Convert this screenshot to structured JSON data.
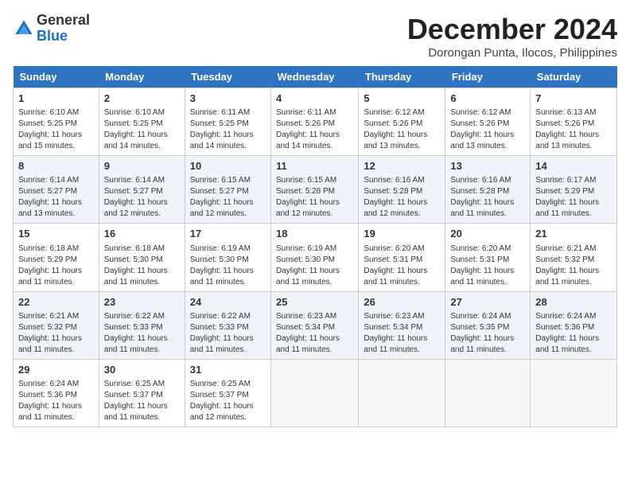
{
  "header": {
    "logo_general": "General",
    "logo_blue": "Blue",
    "month_year": "December 2024",
    "location": "Dorongan Punta, Ilocos, Philippines"
  },
  "columns": [
    "Sunday",
    "Monday",
    "Tuesday",
    "Wednesday",
    "Thursday",
    "Friday",
    "Saturday"
  ],
  "weeks": [
    [
      {
        "day": "1",
        "sunrise": "6:10 AM",
        "sunset": "5:25 PM",
        "daylight": "11 hours and 15 minutes."
      },
      {
        "day": "2",
        "sunrise": "6:10 AM",
        "sunset": "5:25 PM",
        "daylight": "11 hours and 14 minutes."
      },
      {
        "day": "3",
        "sunrise": "6:11 AM",
        "sunset": "5:25 PM",
        "daylight": "11 hours and 14 minutes."
      },
      {
        "day": "4",
        "sunrise": "6:11 AM",
        "sunset": "5:26 PM",
        "daylight": "11 hours and 14 minutes."
      },
      {
        "day": "5",
        "sunrise": "6:12 AM",
        "sunset": "5:26 PM",
        "daylight": "11 hours and 13 minutes."
      },
      {
        "day": "6",
        "sunrise": "6:12 AM",
        "sunset": "5:26 PM",
        "daylight": "11 hours and 13 minutes."
      },
      {
        "day": "7",
        "sunrise": "6:13 AM",
        "sunset": "5:26 PM",
        "daylight": "11 hours and 13 minutes."
      }
    ],
    [
      {
        "day": "8",
        "sunrise": "6:14 AM",
        "sunset": "5:27 PM",
        "daylight": "11 hours and 13 minutes."
      },
      {
        "day": "9",
        "sunrise": "6:14 AM",
        "sunset": "5:27 PM",
        "daylight": "11 hours and 12 minutes."
      },
      {
        "day": "10",
        "sunrise": "6:15 AM",
        "sunset": "5:27 PM",
        "daylight": "11 hours and 12 minutes."
      },
      {
        "day": "11",
        "sunrise": "6:15 AM",
        "sunset": "5:28 PM",
        "daylight": "11 hours and 12 minutes."
      },
      {
        "day": "12",
        "sunrise": "6:16 AM",
        "sunset": "5:28 PM",
        "daylight": "11 hours and 12 minutes."
      },
      {
        "day": "13",
        "sunrise": "6:16 AM",
        "sunset": "5:28 PM",
        "daylight": "11 hours and 11 minutes."
      },
      {
        "day": "14",
        "sunrise": "6:17 AM",
        "sunset": "5:29 PM",
        "daylight": "11 hours and 11 minutes."
      }
    ],
    [
      {
        "day": "15",
        "sunrise": "6:18 AM",
        "sunset": "5:29 PM",
        "daylight": "11 hours and 11 minutes."
      },
      {
        "day": "16",
        "sunrise": "6:18 AM",
        "sunset": "5:30 PM",
        "daylight": "11 hours and 11 minutes."
      },
      {
        "day": "17",
        "sunrise": "6:19 AM",
        "sunset": "5:30 PM",
        "daylight": "11 hours and 11 minutes."
      },
      {
        "day": "18",
        "sunrise": "6:19 AM",
        "sunset": "5:30 PM",
        "daylight": "11 hours and 11 minutes."
      },
      {
        "day": "19",
        "sunrise": "6:20 AM",
        "sunset": "5:31 PM",
        "daylight": "11 hours and 11 minutes."
      },
      {
        "day": "20",
        "sunrise": "6:20 AM",
        "sunset": "5:31 PM",
        "daylight": "11 hours and 11 minutes."
      },
      {
        "day": "21",
        "sunrise": "6:21 AM",
        "sunset": "5:32 PM",
        "daylight": "11 hours and 11 minutes."
      }
    ],
    [
      {
        "day": "22",
        "sunrise": "6:21 AM",
        "sunset": "5:32 PM",
        "daylight": "11 hours and 11 minutes."
      },
      {
        "day": "23",
        "sunrise": "6:22 AM",
        "sunset": "5:33 PM",
        "daylight": "11 hours and 11 minutes."
      },
      {
        "day": "24",
        "sunrise": "6:22 AM",
        "sunset": "5:33 PM",
        "daylight": "11 hours and 11 minutes."
      },
      {
        "day": "25",
        "sunrise": "6:23 AM",
        "sunset": "5:34 PM",
        "daylight": "11 hours and 11 minutes."
      },
      {
        "day": "26",
        "sunrise": "6:23 AM",
        "sunset": "5:34 PM",
        "daylight": "11 hours and 11 minutes."
      },
      {
        "day": "27",
        "sunrise": "6:24 AM",
        "sunset": "5:35 PM",
        "daylight": "11 hours and 11 minutes."
      },
      {
        "day": "28",
        "sunrise": "6:24 AM",
        "sunset": "5:36 PM",
        "daylight": "11 hours and 11 minutes."
      }
    ],
    [
      {
        "day": "29",
        "sunrise": "6:24 AM",
        "sunset": "5:36 PM",
        "daylight": "11 hours and 11 minutes."
      },
      {
        "day": "30",
        "sunrise": "6:25 AM",
        "sunset": "5:37 PM",
        "daylight": "11 hours and 11 minutes."
      },
      {
        "day": "31",
        "sunrise": "6:25 AM",
        "sunset": "5:37 PM",
        "daylight": "11 hours and 12 minutes."
      },
      null,
      null,
      null,
      null
    ]
  ]
}
